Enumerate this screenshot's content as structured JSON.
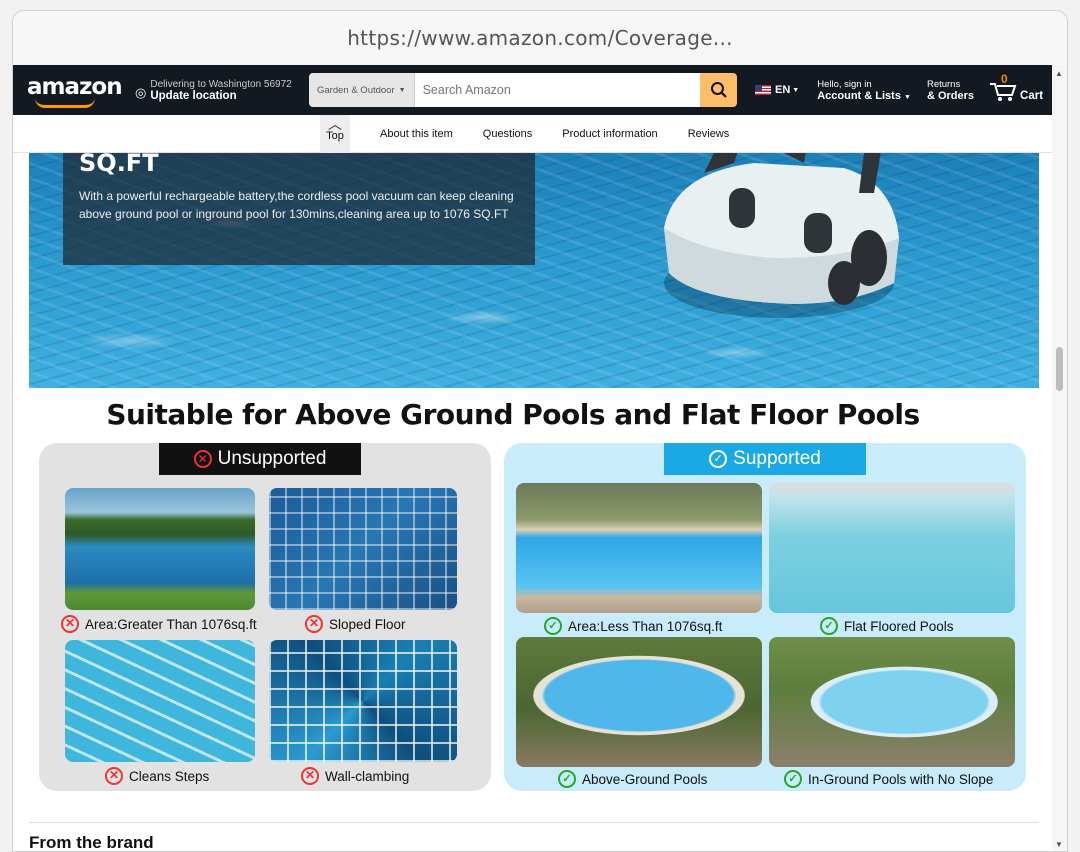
{
  "browser": {
    "url": "https://www.amazon.com/Coverage..."
  },
  "header": {
    "logo": "amazon",
    "deliver_line1": "Delivering to Washington 56972",
    "deliver_line2": "Update location",
    "search_category": "Garden & Outdoor",
    "search_placeholder": "Search Amazon",
    "language": "EN",
    "account_line1": "Hello, sign in",
    "account_line2": "Account & Lists",
    "orders_line1": "Returns",
    "orders_line2": "& Orders",
    "cart_count": "0",
    "cart_label": "Cart"
  },
  "subnav": {
    "top_label": "Top",
    "items": [
      "About this item",
      "Questions",
      "Product information",
      "Reviews"
    ]
  },
  "banner": {
    "title": "SQ.FT",
    "body": "With a powerful rechargeable battery,the cordless pool vacuum can keep cleaning above ground pool or inground pool for 130mins,cleaning area up to 1076 SQ.FT"
  },
  "suitable": {
    "heading": "Suitable for Above Ground Pools and Flat Floor Pools",
    "unsupported": {
      "tag": "Unsupported",
      "items": [
        "Area:Greater Than 1076sq.ft",
        "Sloped Floor",
        "Cleans Steps",
        "Wall-clambing"
      ]
    },
    "supported": {
      "tag": "Supported",
      "items": [
        "Area:Less Than 1076sq.ft",
        "Flat Floored Pools",
        "Above-Ground Pools",
        "In-Ground Pools with No Slope"
      ]
    }
  },
  "footer_section": {
    "title": "From the brand"
  },
  "colors": {
    "header_bg": "#131921",
    "accent": "#ff9900",
    "search_button": "#febd69",
    "supported": "#1ba9e6",
    "unsupported": "#111111"
  }
}
